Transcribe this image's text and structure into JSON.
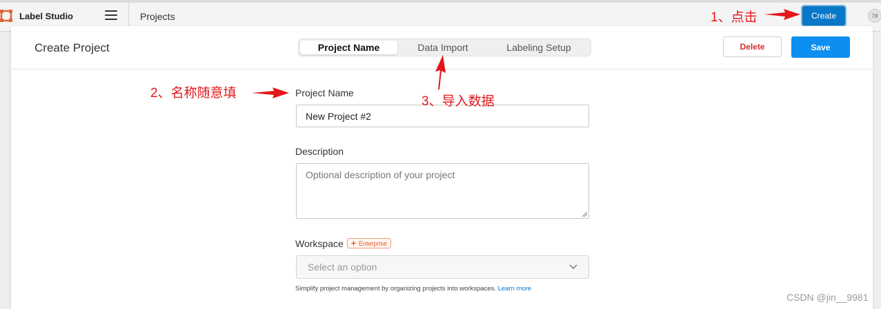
{
  "app": {
    "name": "Label Studio",
    "nav_title": "Projects",
    "avatar_text": "78"
  },
  "topbar": {
    "create_label": "Create"
  },
  "modal": {
    "title": "Create Project",
    "steps": [
      {
        "label": "Project Name",
        "active": true
      },
      {
        "label": "Data Import",
        "active": false
      },
      {
        "label": "Labeling Setup",
        "active": false
      }
    ],
    "delete_label": "Delete",
    "save_label": "Save"
  },
  "form": {
    "project_name_label": "Project Name",
    "project_name_value": "New Project #2",
    "description_label": "Description",
    "description_placeholder": "Optional description of your project",
    "workspace_label": "Workspace",
    "enterprise_badge": "Enterprise",
    "workspace_select_placeholder": "Select an option",
    "help_text": "Simplify project management by organizing projects into workspaces.",
    "learn_more": "Learn more"
  },
  "annotations": {
    "step1": "1、点击",
    "step2": "2、名称随意填",
    "step3": "3、导入数据"
  },
  "watermark": "CSDN @jin__9981",
  "colors": {
    "accent": "#0d8ff0",
    "annotation": "#e3171b",
    "delete": "#d32f2f",
    "enterprise": "#e35d2d"
  },
  "icons": [
    "logo-icon",
    "hamburger-menu-icon",
    "sparkle-icon",
    "chevron-down-icon",
    "resize-grip-icon"
  ]
}
